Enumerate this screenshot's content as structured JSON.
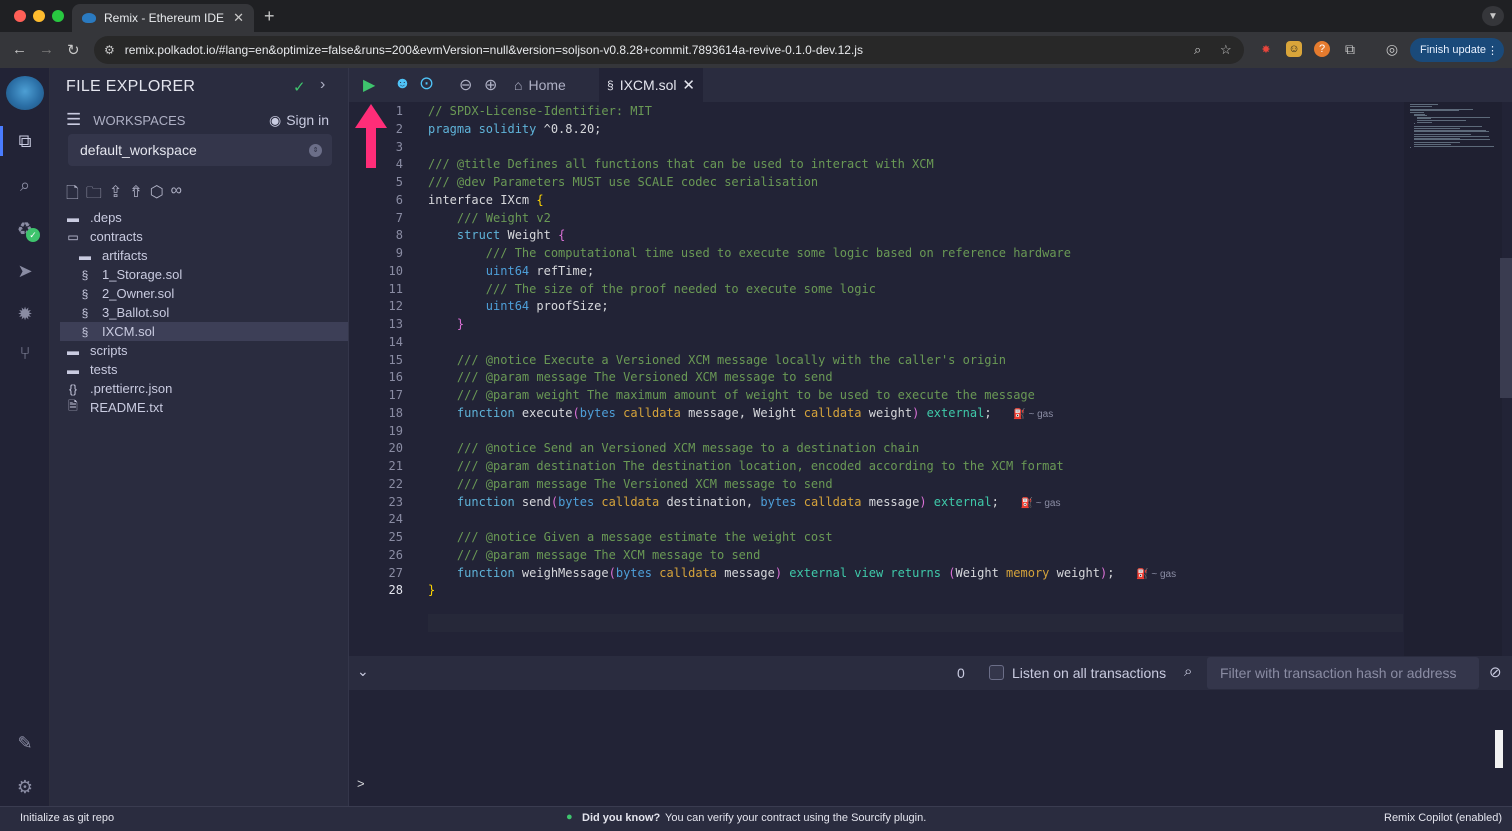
{
  "browser": {
    "tab_title": "Remix - Ethereum IDE",
    "tab_close": "✕",
    "new_tab": "+",
    "url": "remix.polkadot.io/#lang=en&optimize=false&runs=200&evmVersion=null&version=soljson-v0.8.28+commit.7893614a-revive-0.1.0-dev.12.js",
    "finish_update": "Finish update",
    "menu_dots": "⋮"
  },
  "sidebar": {
    "title": "FILE EXPLORER",
    "workspaces_label": "WORKSPACES",
    "sign_in": "Sign in",
    "workspace_selected": "default_workspace",
    "tree": [
      {
        "label": ".deps",
        "type": "folder",
        "depth": 0
      },
      {
        "label": "contracts",
        "type": "folder-open",
        "depth": 0
      },
      {
        "label": "artifacts",
        "type": "folder",
        "depth": 1
      },
      {
        "label": "1_Storage.sol",
        "type": "sol",
        "depth": 1
      },
      {
        "label": "2_Owner.sol",
        "type": "sol",
        "depth": 1
      },
      {
        "label": "3_Ballot.sol",
        "type": "sol",
        "depth": 1
      },
      {
        "label": "IXCM.sol",
        "type": "sol",
        "depth": 1,
        "selected": true
      },
      {
        "label": "scripts",
        "type": "folder",
        "depth": 0
      },
      {
        "label": "tests",
        "type": "folder",
        "depth": 0
      },
      {
        "label": ".prettierrc.json",
        "type": "json",
        "depth": 0
      },
      {
        "label": "README.txt",
        "type": "txt",
        "depth": 0
      }
    ]
  },
  "editor": {
    "tab_home": "Home",
    "tab_file": "IXCM.sol",
    "current_line": 28,
    "gas_label": "~ gas"
  },
  "terminal": {
    "count": "0",
    "listen_label": "Listen on all transactions",
    "filter_placeholder": "Filter with transaction hash or address",
    "prompt": ">"
  },
  "statusbar": {
    "left": "Initialize as git repo",
    "tip_bold": "Did you know?",
    "tip_text": "You can verify your contract using the Sourcify plugin.",
    "right": "Remix Copilot (enabled)"
  },
  "colors": {
    "accent": "#4a7cff",
    "annotation_arrow": "#ff2d78",
    "success": "#3ec46d"
  }
}
